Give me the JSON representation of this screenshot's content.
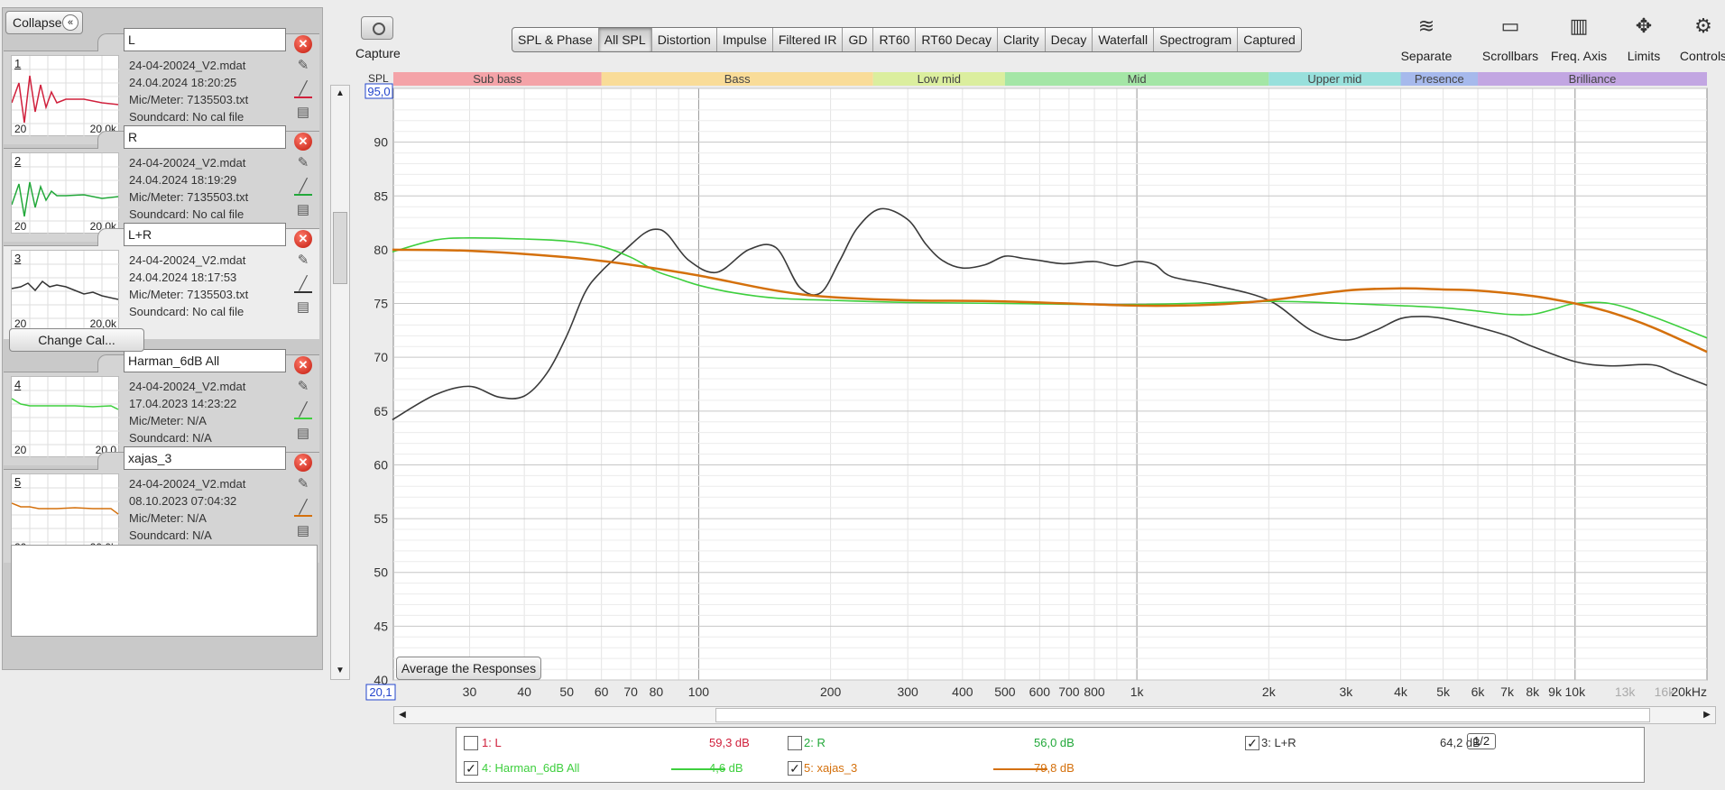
{
  "panel": {
    "collapse_label": "Collapse",
    "collapse_icon": "double-chevron-left-icon",
    "change_cal_label": "Change Cal...",
    "measurements": [
      {
        "index": "1",
        "name": "L",
        "file": "24-04-20024_V2.mdat",
        "date": "24.04.2024 18:20:25",
        "mic": "Mic/Meter: 7135503.txt",
        "soundcard": "Soundcard: No cal file",
        "color": "#d0203c",
        "axis_lo": "20",
        "axis_hi": "20,0k"
      },
      {
        "index": "2",
        "name": "R",
        "file": "24-04-20024_V2.mdat",
        "date": "24.04.2024 18:19:29",
        "mic": "Mic/Meter: 7135503.txt",
        "soundcard": "Soundcard: No cal file",
        "color": "#22a83a",
        "axis_lo": "20",
        "axis_hi": "20,0k"
      },
      {
        "index": "3",
        "name": "L+R",
        "file": "24-04-20024_V2.mdat",
        "date": "24.04.2024 18:17:53",
        "mic": "Mic/Meter: 7135503.txt",
        "soundcard": "Soundcard: No cal file",
        "color": "#333333",
        "axis_lo": "20",
        "axis_hi": "20,0k"
      },
      {
        "index": "4",
        "name": "Harman_6dB All",
        "file": "24-04-20024_V2.mdat",
        "date": "17.04.2023 14:23:22",
        "mic": "Mic/Meter: N/A",
        "soundcard": "Soundcard: N/A",
        "color": "#3ecf3e",
        "axis_lo": "20",
        "axis_hi": "20,0"
      },
      {
        "index": "5",
        "name": "xajas_3",
        "file": "24-04-20024_V2.mdat",
        "date": "08.10.2023 07:04:32",
        "mic": "Mic/Meter: N/A",
        "soundcard": "Soundcard: N/A",
        "color": "#d4700c",
        "axis_lo": "20",
        "axis_hi": "20,0k"
      }
    ]
  },
  "capture": {
    "label": "Capture",
    "icon": "camera-icon"
  },
  "tabs": [
    "SPL & Phase",
    "All SPL",
    "Distortion",
    "Impulse",
    "Filtered IR",
    "GD",
    "RT60",
    "RT60 Decay",
    "Clarity",
    "Decay",
    "Waterfall",
    "Spectrogram",
    "Captured"
  ],
  "active_tab": "All SPL",
  "tools": [
    {
      "label": "Separate",
      "icon": "separate-traces-icon"
    },
    {
      "label": "Scrollbars",
      "icon": "scrollbars-icon"
    },
    {
      "label": "Freq. Axis",
      "icon": "freq-axis-icon"
    },
    {
      "label": "Limits",
      "icon": "limits-arrows-icon"
    },
    {
      "label": "Controls",
      "icon": "gear-icon"
    }
  ],
  "average_label": "Average the Responses",
  "colors": {
    "grid": "#c8c8c8",
    "accent": "#2244cc"
  },
  "bands": [
    {
      "name": "Sub bass",
      "from": 20,
      "to": 60,
      "color": "#f4a3a8"
    },
    {
      "name": "Bass",
      "from": 60,
      "to": 250,
      "color": "#f9dc98"
    },
    {
      "name": "Low mid",
      "from": 250,
      "to": 500,
      "color": "#dbee9e"
    },
    {
      "name": "Mid",
      "from": 500,
      "to": 2000,
      "color": "#a4e6a6"
    },
    {
      "name": "Upper mid",
      "from": 2000,
      "to": 4000,
      "color": "#98e0dc"
    },
    {
      "name": "Presence",
      "from": 4000,
      "to": 6000,
      "color": "#a6b9ec"
    },
    {
      "name": "Brilliance",
      "from": 6000,
      "to": 20000,
      "color": "#c2a6e2"
    }
  ],
  "chart_data": {
    "type": "line",
    "ylabel": "SPL",
    "y_top_label": "95,0",
    "x_left_label": "20,1",
    "xlim": [
      20.1,
      20000
    ],
    "ylim": [
      40,
      95
    ],
    "x_scale": "log",
    "y_ticks": [
      40,
      45,
      50,
      55,
      60,
      65,
      70,
      75,
      80,
      85,
      90
    ],
    "x_ticks": [
      {
        "v": 30,
        "t": "30"
      },
      {
        "v": 40,
        "t": "40"
      },
      {
        "v": 50,
        "t": "50"
      },
      {
        "v": 60,
        "t": "60"
      },
      {
        "v": 70,
        "t": "70"
      },
      {
        "v": 80,
        "t": "80"
      },
      {
        "v": 100,
        "t": "100"
      },
      {
        "v": 200,
        "t": "200"
      },
      {
        "v": 300,
        "t": "300"
      },
      {
        "v": 400,
        "t": "400"
      },
      {
        "v": 500,
        "t": "500"
      },
      {
        "v": 600,
        "t": "600"
      },
      {
        "v": 700,
        "t": "700"
      },
      {
        "v": 800,
        "t": "800"
      },
      {
        "v": 1000,
        "t": "1k"
      },
      {
        "v": 2000,
        "t": "2k"
      },
      {
        "v": 3000,
        "t": "3k"
      },
      {
        "v": 4000,
        "t": "4k"
      },
      {
        "v": 5000,
        "t": "5k"
      },
      {
        "v": 6000,
        "t": "6k"
      },
      {
        "v": 7000,
        "t": "7k"
      },
      {
        "v": 8000,
        "t": "8k"
      },
      {
        "v": 9000,
        "t": "9k"
      },
      {
        "v": 10000,
        "t": "10k"
      },
      {
        "v": 13000,
        "t": "13k"
      },
      {
        "v": 16000,
        "t": "16k"
      },
      {
        "v": 20000,
        "t": "20kHz"
      }
    ],
    "grid": true,
    "series": [
      {
        "name": "L+R",
        "color": "#3a3a3a",
        "x": [
          20,
          25,
          30,
          35,
          40,
          45,
          50,
          55,
          60,
          68,
          75,
          80,
          85,
          95,
          110,
          130,
          150,
          170,
          190,
          210,
          230,
          260,
          300,
          330,
          360,
          400,
          450,
          500,
          550,
          600,
          680,
          800,
          900,
          1000,
          1100,
          1200,
          1500,
          2000,
          2500,
          3000,
          3500,
          4000,
          4500,
          5000,
          6000,
          7000,
          8000,
          10000,
          12000,
          15000,
          17000,
          20000
        ],
        "y": [
          64.2,
          66.5,
          67.3,
          66.3,
          66.4,
          68.5,
          72,
          76,
          78,
          80,
          81.5,
          81.9,
          81.4,
          79,
          77.9,
          80,
          80.2,
          76.5,
          76,
          79,
          82,
          83.8,
          82.8,
          80.5,
          79,
          78.3,
          78.6,
          79.4,
          79.2,
          79,
          78.7,
          78.9,
          78.5,
          78.9,
          78.6,
          77.5,
          76.7,
          75.3,
          72.5,
          71.6,
          72.5,
          73.6,
          73.8,
          73.6,
          72.8,
          72,
          71,
          69.6,
          69.2,
          69.3,
          68.5,
          67.4
        ]
      },
      {
        "name": "Harman_6dB All",
        "color": "#3ecf3e",
        "x": [
          20,
          25,
          30,
          40,
          50,
          60,
          70,
          80,
          90,
          100,
          120,
          150,
          200,
          300,
          500,
          1000,
          2000,
          3000,
          4000,
          5000,
          6000,
          7000,
          8000,
          9000,
          10000,
          12000,
          15000,
          20000
        ],
        "y": [
          79.8,
          80.9,
          81.1,
          81,
          80.8,
          80.3,
          79.3,
          78,
          77.3,
          76.7,
          76,
          75.5,
          75.3,
          75.1,
          75,
          74.9,
          75.2,
          75,
          74.8,
          74.6,
          74.3,
          74,
          74,
          74.5,
          75,
          75,
          73.8,
          71.8
        ]
      },
      {
        "name": "xajas_3",
        "color": "#d4700c",
        "x": [
          20,
          30,
          50,
          70,
          100,
          150,
          200,
          300,
          500,
          1000,
          1500,
          2000,
          3000,
          4000,
          5000,
          6000,
          8000,
          10000,
          12000,
          15000,
          20000
        ],
        "y": [
          80,
          79.9,
          79.3,
          78.6,
          77.6,
          76.2,
          75.6,
          75.3,
          75.2,
          74.8,
          74.9,
          75.3,
          76.2,
          76.4,
          76.3,
          76.2,
          75.7,
          75,
          74.2,
          72.8,
          70.5
        ]
      }
    ]
  },
  "legend": {
    "items": [
      {
        "label": "1: L",
        "checked": false,
        "value": "59,3 dB",
        "color": "#d0203c"
      },
      {
        "label": "2: R",
        "checked": false,
        "value": "56,0 dB",
        "color": "#22a83a"
      },
      {
        "label": "3: L+R",
        "checked": true,
        "value": "64,2 dB",
        "color": "#333333",
        "smoothing": "1/2"
      },
      {
        "label": "4: Harman_6dB All",
        "checked": true,
        "value": "4,6 dB",
        "color": "#3ecf3e"
      },
      {
        "label": "5: xajas_3",
        "checked": true,
        "value": "79,8 dB",
        "color": "#d4700c"
      }
    ]
  }
}
